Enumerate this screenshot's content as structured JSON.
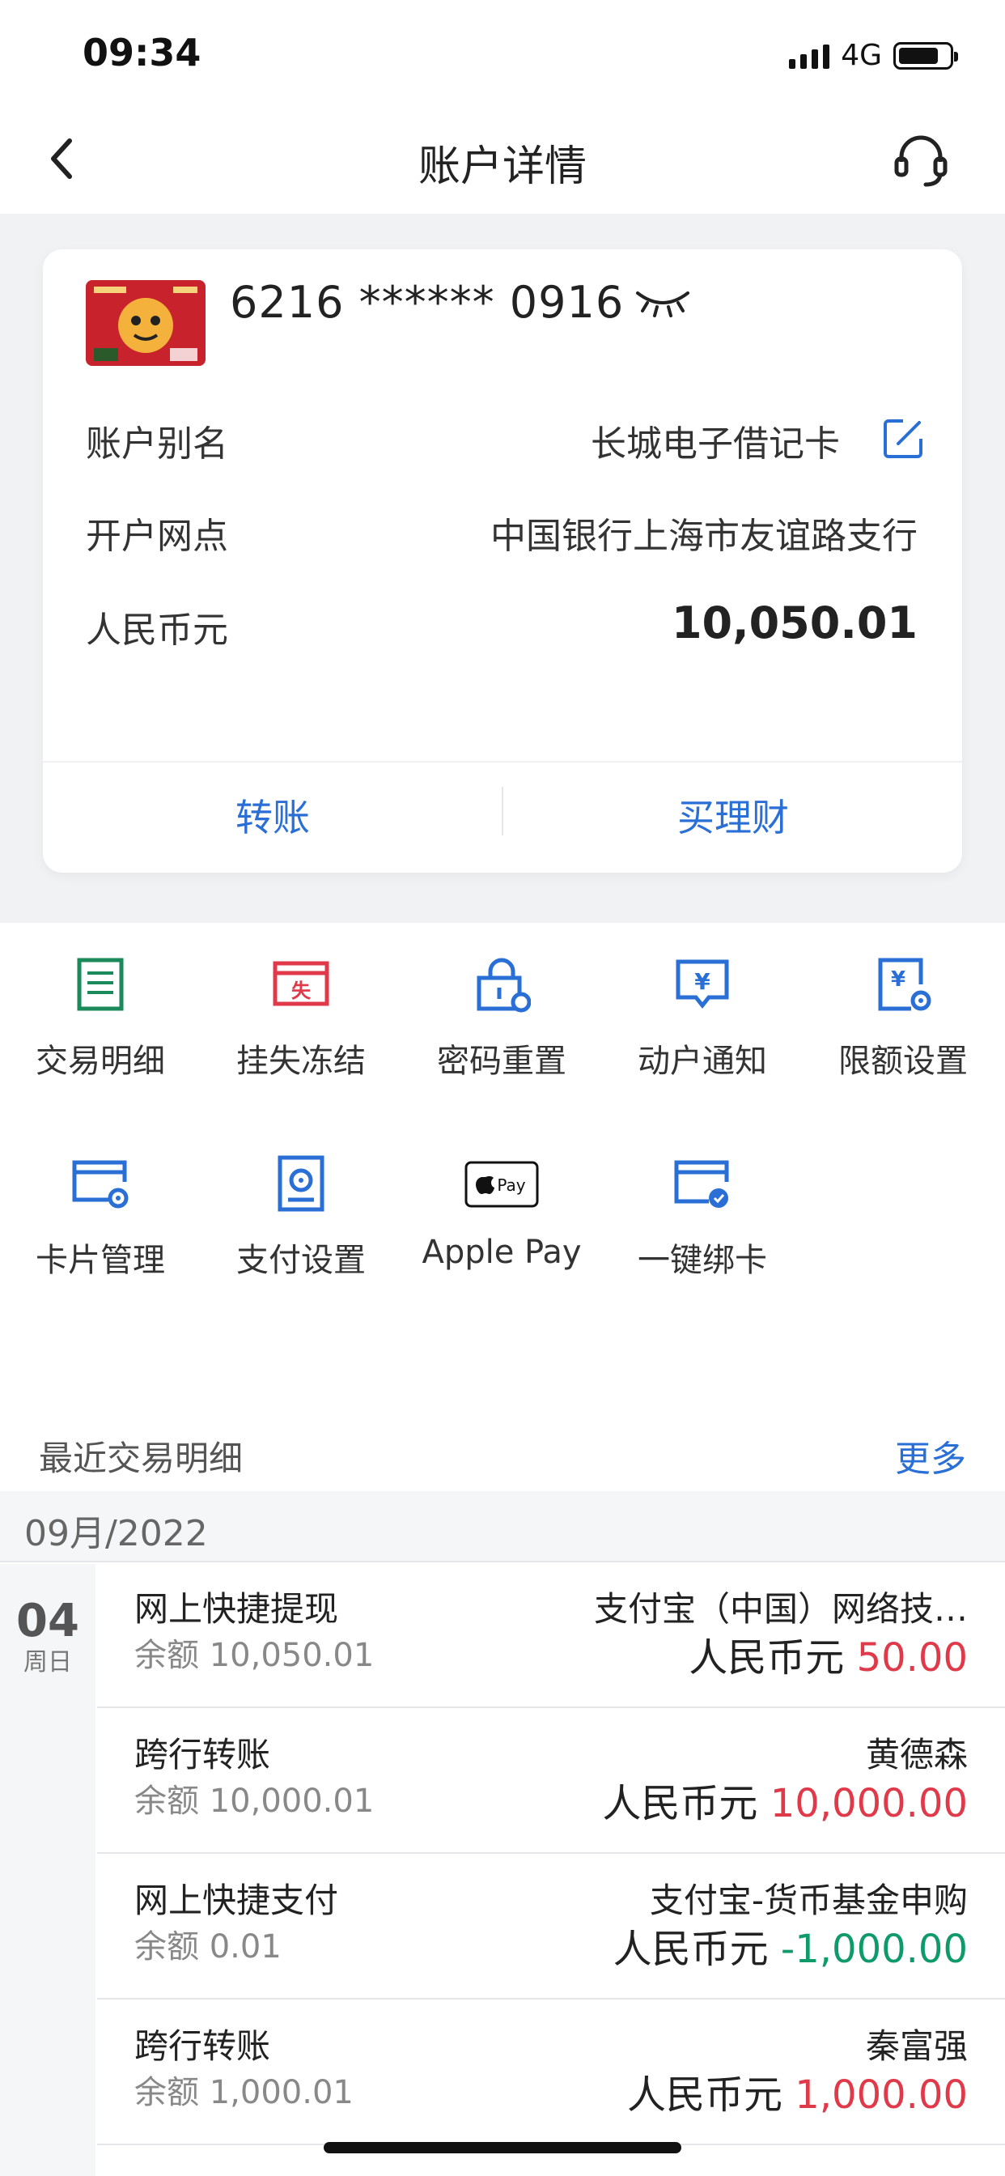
{
  "status_bar": {
    "time": "09:34",
    "network": "4G"
  },
  "nav": {
    "title": "账户详情",
    "back_icon": "chevron-left-icon",
    "service_icon": "headset-icon"
  },
  "account_card": {
    "card_number": "6216 ****** 0916",
    "alias_label": "账户别名",
    "alias_value": "长城电子借记卡",
    "branch_label": "开户网点",
    "branch_value": "中国银行上海市友谊路支行",
    "currency_label": "人民币元",
    "balance": "10,050.01",
    "actions": [
      {
        "label": "转账"
      },
      {
        "label": "买理财"
      }
    ]
  },
  "functions": [
    {
      "label": "交易明细",
      "icon": "list-icon",
      "color": "#1a8a5a"
    },
    {
      "label": "挂失冻结",
      "icon": "report-loss-icon",
      "color": "#e03a4a",
      "icon_text": "失"
    },
    {
      "label": "密码重置",
      "icon": "lock-reset-icon",
      "color": "#2a6fd6"
    },
    {
      "label": "动户通知",
      "icon": "notify-icon",
      "color": "#2a6fd6",
      "icon_text": "¥"
    },
    {
      "label": "限额设置",
      "icon": "limit-settings-icon",
      "color": "#2a6fd6",
      "icon_text": "¥"
    },
    {
      "label": "卡片管理",
      "icon": "card-settings-icon",
      "color": "#2a6fd6"
    },
    {
      "label": "支付设置",
      "icon": "pay-settings-icon",
      "color": "#2a6fd6"
    },
    {
      "label": "Apple Pay",
      "icon": "apple-pay-icon",
      "color": "#111111",
      "icon_text": "Pay"
    },
    {
      "label": "一键绑卡",
      "icon": "bind-card-icon",
      "color": "#2a6fd6"
    }
  ],
  "recent": {
    "title": "最近交易明细",
    "more": "更多",
    "month": "09月/2022",
    "day": "04",
    "weekday": "周日",
    "transactions": [
      {
        "type": "网上快捷提现",
        "balance": "余额 10,050.01",
        "party": "支付宝（中国）网络技…",
        "currency": "人民币元",
        "amount": "50.00",
        "sign": "in"
      },
      {
        "type": "跨行转账",
        "balance": "余额 10,000.01",
        "party": "黄德森",
        "currency": "人民币元",
        "amount": "10,000.00",
        "sign": "in"
      },
      {
        "type": "网上快捷支付",
        "balance": "余额 0.01",
        "party": "支付宝-货币基金申购",
        "currency": "人民币元",
        "amount": "-1,000.00",
        "sign": "out"
      },
      {
        "type": "跨行转账",
        "balance": "余额 1,000.01",
        "party": "秦富强",
        "currency": "人民币元",
        "amount": "1,000.00",
        "sign": "in"
      }
    ]
  }
}
